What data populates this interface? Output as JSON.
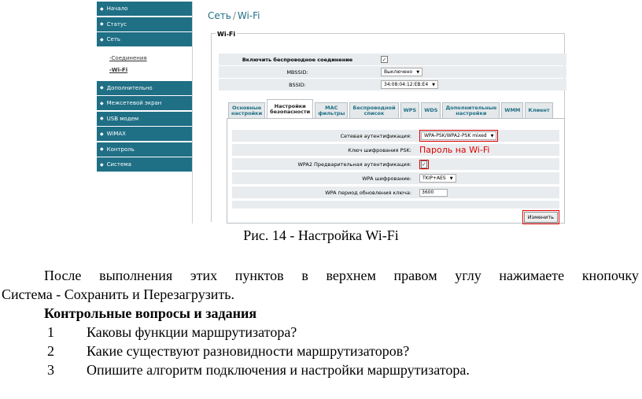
{
  "sidebar": {
    "items": [
      {
        "label": "Начало"
      },
      {
        "label": "Статус"
      },
      {
        "label": "Сеть"
      },
      {
        "label": "Дополнительно"
      },
      {
        "label": "Межсетевой экран"
      },
      {
        "label": "USB модем"
      },
      {
        "label": "WiMAX"
      },
      {
        "label": "Контроль"
      },
      {
        "label": "Система"
      }
    ],
    "subitems": [
      {
        "label": "Соединения"
      },
      {
        "label": "Wi-Fi"
      }
    ]
  },
  "breadcrumb": {
    "section": "Сеть",
    "separator": "/",
    "page": "Wi-Fi"
  },
  "wifi": {
    "legend": "Wi-Fi",
    "enable_label": "Включить беспроводное соединение",
    "mbssid_label": "MBSSID:",
    "mbssid_value": "Выключено",
    "bssid_label": "BSSID:",
    "bssid_value": "34:08:04:12:EB:E4"
  },
  "tabs": [
    "Основные\nнастройки",
    "Настройки\nбезопасности",
    "MAC\nфильтры",
    "Беспроводной\nсписок",
    "WPS",
    "WDS",
    "Дополнительные\nнастройки",
    "WMM",
    "Клиент"
  ],
  "security": {
    "auth_label": "Сетевая аутентификация:",
    "auth_value": "WPA-PSK/WPA2-PSK mixed",
    "psk_label": "Ключ шифрования PSK:",
    "psk_annotation": "Пароль на Wi-Fi",
    "preauth_label": "WPA2 Предварительная аутентификация:",
    "enc_label": "WPA шифрование:",
    "enc_value": "TKIP+AES",
    "period_label": "WPA период обновления ключа:",
    "period_value": "3600",
    "change_button": "Изменить"
  },
  "document": {
    "caption": "Рис. 14 - Настройка Wi-Fi",
    "paragraph_line1": [
      "После",
      "выполнения",
      "этих",
      "пунктов",
      "в",
      "верхнем",
      "правом",
      "углу",
      "нажимаете",
      "кнопочку"
    ],
    "paragraph_line2": "Система - Сохранить и Перезагрузить.",
    "heading": "Контрольные вопросы и задания",
    "questions": [
      {
        "num": "1",
        "text": "Каковы функции маршрутизатора?"
      },
      {
        "num": "2",
        "text": "Какие существуют разновидности маршрутизаторов?"
      },
      {
        "num": "3",
        "text": "Опишите алгоритм подключения и настройки маршрутизатора."
      }
    ]
  }
}
